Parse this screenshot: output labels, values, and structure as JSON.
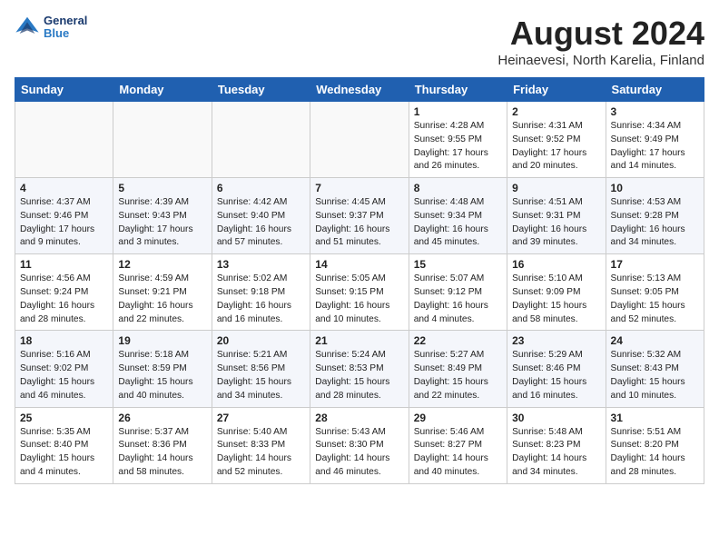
{
  "header": {
    "logo": {
      "general": "General",
      "blue": "Blue"
    },
    "month": "August 2024",
    "location": "Heinaevesi, North Karelia, Finland"
  },
  "weekdays": [
    "Sunday",
    "Monday",
    "Tuesday",
    "Wednesday",
    "Thursday",
    "Friday",
    "Saturday"
  ],
  "weeks": [
    [
      {
        "day": "",
        "info": ""
      },
      {
        "day": "",
        "info": ""
      },
      {
        "day": "",
        "info": ""
      },
      {
        "day": "",
        "info": ""
      },
      {
        "day": "1",
        "info": "Sunrise: 4:28 AM\nSunset: 9:55 PM\nDaylight: 17 hours\nand 26 minutes."
      },
      {
        "day": "2",
        "info": "Sunrise: 4:31 AM\nSunset: 9:52 PM\nDaylight: 17 hours\nand 20 minutes."
      },
      {
        "day": "3",
        "info": "Sunrise: 4:34 AM\nSunset: 9:49 PM\nDaylight: 17 hours\nand 14 minutes."
      }
    ],
    [
      {
        "day": "4",
        "info": "Sunrise: 4:37 AM\nSunset: 9:46 PM\nDaylight: 17 hours\nand 9 minutes."
      },
      {
        "day": "5",
        "info": "Sunrise: 4:39 AM\nSunset: 9:43 PM\nDaylight: 17 hours\nand 3 minutes."
      },
      {
        "day": "6",
        "info": "Sunrise: 4:42 AM\nSunset: 9:40 PM\nDaylight: 16 hours\nand 57 minutes."
      },
      {
        "day": "7",
        "info": "Sunrise: 4:45 AM\nSunset: 9:37 PM\nDaylight: 16 hours\nand 51 minutes."
      },
      {
        "day": "8",
        "info": "Sunrise: 4:48 AM\nSunset: 9:34 PM\nDaylight: 16 hours\nand 45 minutes."
      },
      {
        "day": "9",
        "info": "Sunrise: 4:51 AM\nSunset: 9:31 PM\nDaylight: 16 hours\nand 39 minutes."
      },
      {
        "day": "10",
        "info": "Sunrise: 4:53 AM\nSunset: 9:28 PM\nDaylight: 16 hours\nand 34 minutes."
      }
    ],
    [
      {
        "day": "11",
        "info": "Sunrise: 4:56 AM\nSunset: 9:24 PM\nDaylight: 16 hours\nand 28 minutes."
      },
      {
        "day": "12",
        "info": "Sunrise: 4:59 AM\nSunset: 9:21 PM\nDaylight: 16 hours\nand 22 minutes."
      },
      {
        "day": "13",
        "info": "Sunrise: 5:02 AM\nSunset: 9:18 PM\nDaylight: 16 hours\nand 16 minutes."
      },
      {
        "day": "14",
        "info": "Sunrise: 5:05 AM\nSunset: 9:15 PM\nDaylight: 16 hours\nand 10 minutes."
      },
      {
        "day": "15",
        "info": "Sunrise: 5:07 AM\nSunset: 9:12 PM\nDaylight: 16 hours\nand 4 minutes."
      },
      {
        "day": "16",
        "info": "Sunrise: 5:10 AM\nSunset: 9:09 PM\nDaylight: 15 hours\nand 58 minutes."
      },
      {
        "day": "17",
        "info": "Sunrise: 5:13 AM\nSunset: 9:05 PM\nDaylight: 15 hours\nand 52 minutes."
      }
    ],
    [
      {
        "day": "18",
        "info": "Sunrise: 5:16 AM\nSunset: 9:02 PM\nDaylight: 15 hours\nand 46 minutes."
      },
      {
        "day": "19",
        "info": "Sunrise: 5:18 AM\nSunset: 8:59 PM\nDaylight: 15 hours\nand 40 minutes."
      },
      {
        "day": "20",
        "info": "Sunrise: 5:21 AM\nSunset: 8:56 PM\nDaylight: 15 hours\nand 34 minutes."
      },
      {
        "day": "21",
        "info": "Sunrise: 5:24 AM\nSunset: 8:53 PM\nDaylight: 15 hours\nand 28 minutes."
      },
      {
        "day": "22",
        "info": "Sunrise: 5:27 AM\nSunset: 8:49 PM\nDaylight: 15 hours\nand 22 minutes."
      },
      {
        "day": "23",
        "info": "Sunrise: 5:29 AM\nSunset: 8:46 PM\nDaylight: 15 hours\nand 16 minutes."
      },
      {
        "day": "24",
        "info": "Sunrise: 5:32 AM\nSunset: 8:43 PM\nDaylight: 15 hours\nand 10 minutes."
      }
    ],
    [
      {
        "day": "25",
        "info": "Sunrise: 5:35 AM\nSunset: 8:40 PM\nDaylight: 15 hours\nand 4 minutes."
      },
      {
        "day": "26",
        "info": "Sunrise: 5:37 AM\nSunset: 8:36 PM\nDaylight: 14 hours\nand 58 minutes."
      },
      {
        "day": "27",
        "info": "Sunrise: 5:40 AM\nSunset: 8:33 PM\nDaylight: 14 hours\nand 52 minutes."
      },
      {
        "day": "28",
        "info": "Sunrise: 5:43 AM\nSunset: 8:30 PM\nDaylight: 14 hours\nand 46 minutes."
      },
      {
        "day": "29",
        "info": "Sunrise: 5:46 AM\nSunset: 8:27 PM\nDaylight: 14 hours\nand 40 minutes."
      },
      {
        "day": "30",
        "info": "Sunrise: 5:48 AM\nSunset: 8:23 PM\nDaylight: 14 hours\nand 34 minutes."
      },
      {
        "day": "31",
        "info": "Sunrise: 5:51 AM\nSunset: 8:20 PM\nDaylight: 14 hours\nand 28 minutes."
      }
    ]
  ]
}
